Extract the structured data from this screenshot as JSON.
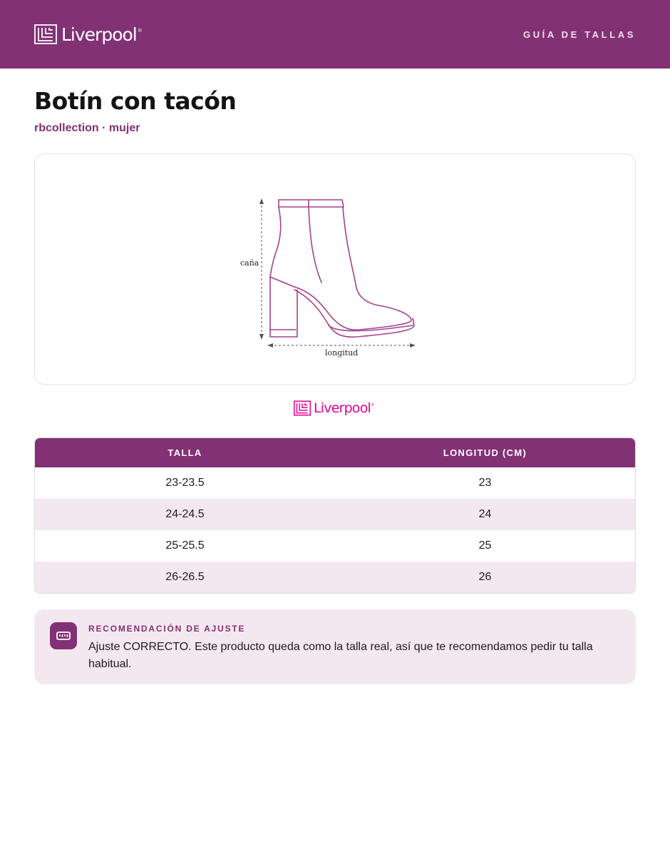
{
  "header": {
    "brand": "Liverpool",
    "brand_mark": "®",
    "link": "GUÍA DE TALLAS"
  },
  "product": {
    "title": "Botín con tacón",
    "subtitle": "rbcollection · mujer"
  },
  "figure": {
    "label_height": "caña",
    "label_length": "longitud",
    "illustration": "ankle-boot-with-heel-outline"
  },
  "table": {
    "headers": [
      "TALLA",
      "LONGITUD (CM)"
    ],
    "rows": [
      [
        "23-23.5",
        "23"
      ],
      [
        "24-24.5",
        "24"
      ],
      [
        "25-25.5",
        "25"
      ],
      [
        "26-26.5",
        "26"
      ]
    ]
  },
  "recommendation": {
    "label": "RECOMENDACIÓN DE AJUSTE",
    "text": "Ajuste CORRECTO. Este producto queda como la talla real, así que te recomendamos pedir tu talla habitual.",
    "icon": "ruler-icon"
  },
  "colors": {
    "brand_purple": "#823174",
    "brand_pink": "#e10098",
    "row_tint": "#f3e8f0"
  }
}
